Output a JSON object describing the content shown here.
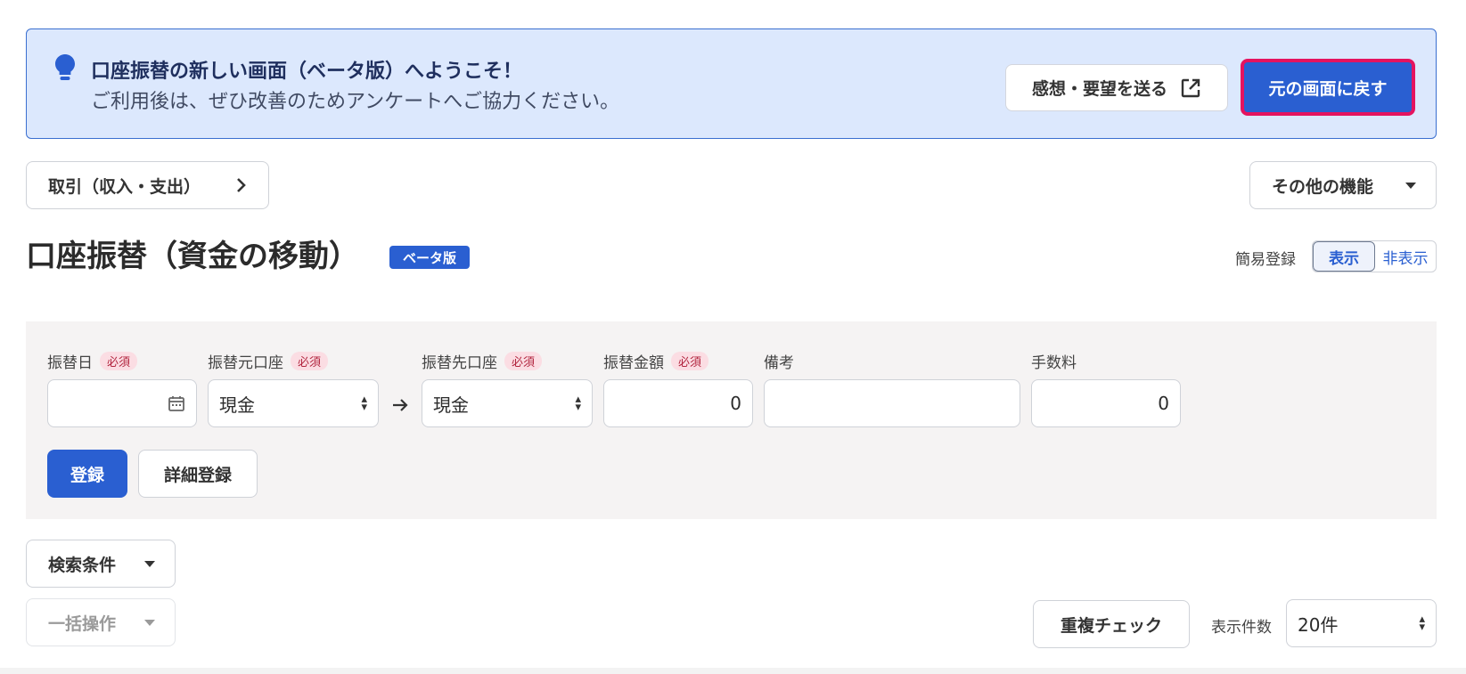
{
  "banner": {
    "title": "口座振替の新しい画面（ベータ版）へようこそ！",
    "subtitle": "ご利用後は、ぜひ改善のためアンケートへご協力ください。",
    "feedback_label": "感想・要望を送る",
    "back_label": "元の画面に戻す"
  },
  "nav": {
    "transactions_label": "取引（収入・支出）",
    "other_label": "その他の機能"
  },
  "page": {
    "title": "口座振替（資金の移動）",
    "beta_badge": "ベータ版",
    "simple_entry_label": "簡易登録",
    "show_label": "表示",
    "hide_label": "非表示"
  },
  "form": {
    "required_label": "必須",
    "date_label": "振替日",
    "date_value": "",
    "from_label": "振替元口座",
    "from_value": "現金",
    "to_label": "振替先口座",
    "to_value": "現金",
    "amount_label": "振替金額",
    "amount_value": "0",
    "memo_label": "備考",
    "memo_value": "",
    "fee_label": "手数料",
    "fee_value": "0",
    "register_label": "登録",
    "detail_register_label": "詳細登録"
  },
  "search": {
    "conditions_label": "検索条件",
    "bulk_label": "一括操作",
    "duplicate_check_label": "重複チェック",
    "per_page_label": "表示件数",
    "per_page_value": "20件"
  },
  "colors": {
    "primary": "#2a5fd1",
    "banner_bg": "#dce8fd",
    "highlight_border": "#e5135f",
    "required_bg": "#fbdde3"
  }
}
